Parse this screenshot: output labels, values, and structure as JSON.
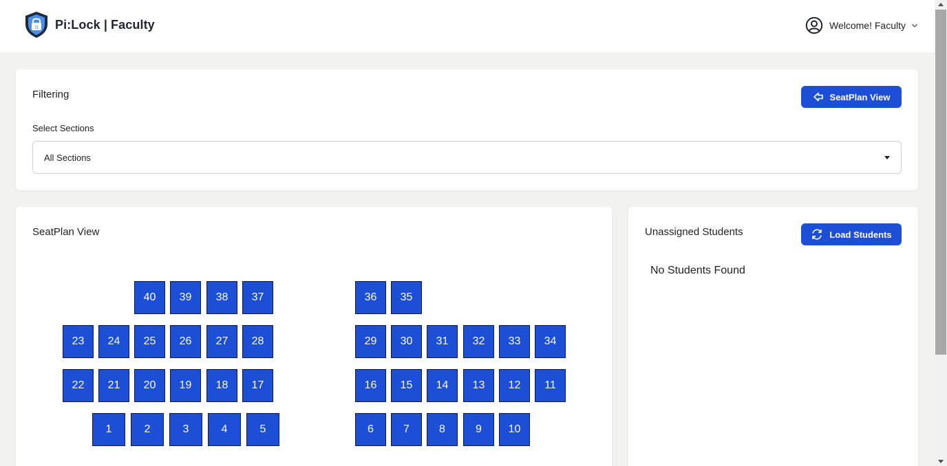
{
  "header": {
    "brand": "Pi:Lock | Faculty",
    "user_label": "Welcome! Faculty",
    "logo_icon": "shield-lock-icon",
    "user_icon": "user-circle-icon"
  },
  "filtering": {
    "title": "Filtering",
    "seatplan_button": "SeatPlan View",
    "select_label": "Select Sections",
    "select_value": "All Sections"
  },
  "seatplan": {
    "title": "SeatPlan View",
    "seats": [
      "1",
      "2",
      "3",
      "4",
      "5",
      "6",
      "7",
      "8",
      "9",
      "10",
      "11",
      "12",
      "13",
      "14",
      "15",
      "16",
      "17",
      "18",
      "19",
      "20",
      "21",
      "22",
      "23",
      "24",
      "25",
      "26",
      "27",
      "28",
      "29",
      "30",
      "31",
      "32",
      "33",
      "34",
      "35",
      "36",
      "37",
      "38",
      "39",
      "40"
    ]
  },
  "unassigned": {
    "title": "Unassigned Students",
    "load_button": "Load Students",
    "empty_message": "No Students Found"
  },
  "colors": {
    "accent": "#1c4fd6",
    "background": "#f2f2f1"
  }
}
